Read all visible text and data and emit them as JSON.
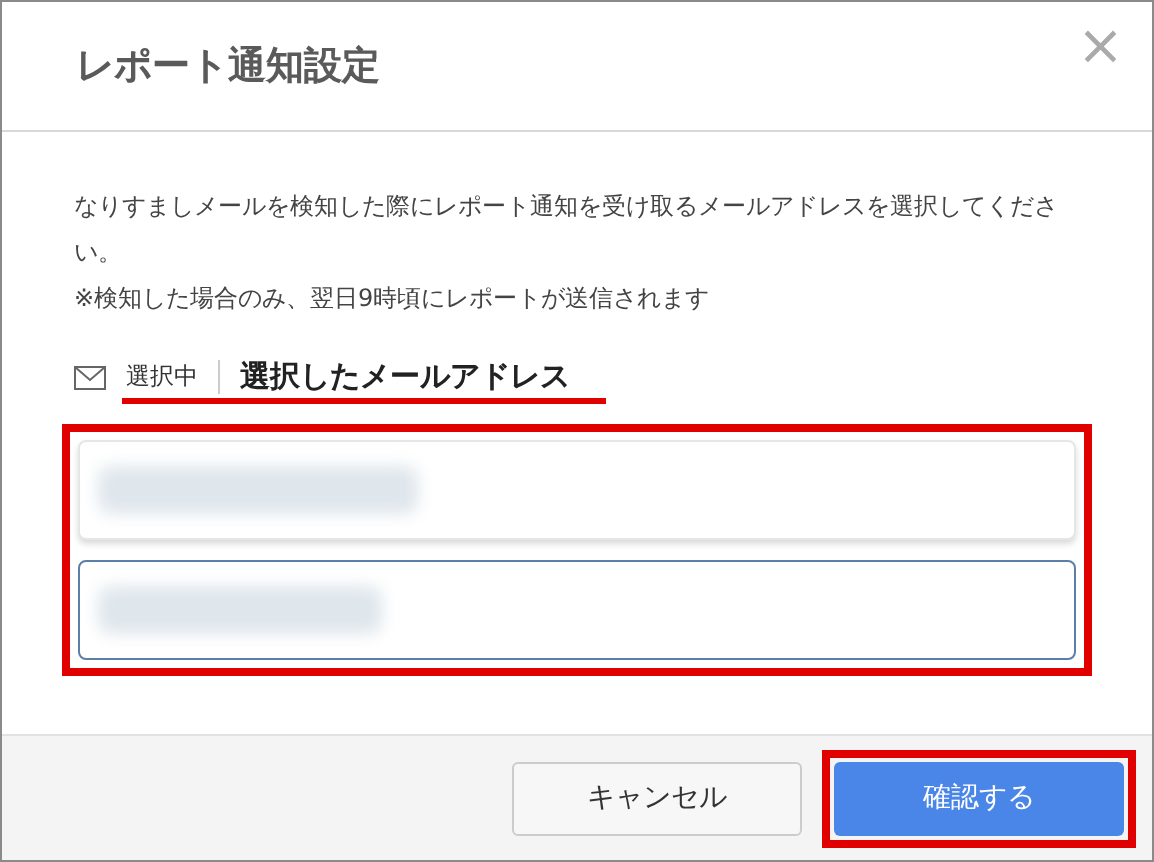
{
  "dialog": {
    "title": "レポート通知設定",
    "close": "×"
  },
  "description": [
    "なりすましメールを検知した際にレポート通知を受け取るメールアドレスを選択してください。",
    "※検知した場合のみ、翌日9時頃にレポートが送信されます"
  ],
  "selection": {
    "status": "選択中",
    "heading": "選択したメールアドレス"
  },
  "addresses": [
    {
      "selected": false,
      "kind": "redacted"
    },
    {
      "selected": true,
      "kind": "redacted"
    }
  ],
  "buttons": [
    {
      "label": "キャンセル",
      "kind": "secondary"
    },
    {
      "label": "確認する",
      "kind": "primary"
    }
  ]
}
